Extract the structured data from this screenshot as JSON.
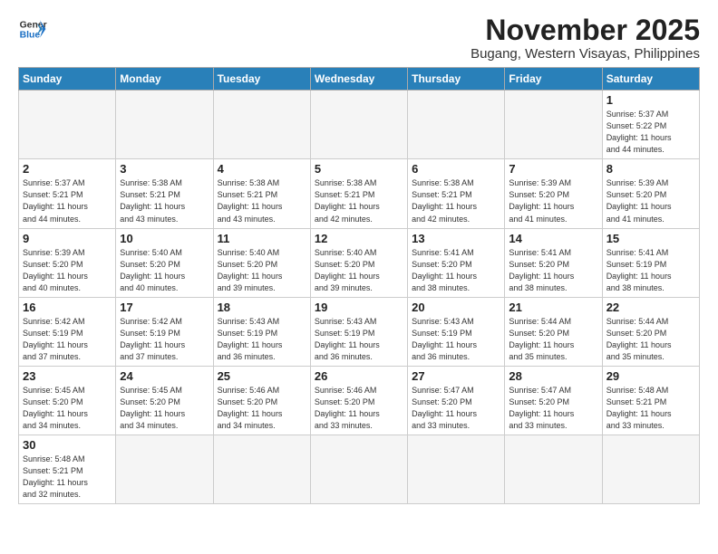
{
  "header": {
    "logo_general": "General",
    "logo_blue": "Blue",
    "title": "November 2025",
    "subtitle": "Bugang, Western Visayas, Philippines"
  },
  "weekdays": [
    "Sunday",
    "Monday",
    "Tuesday",
    "Wednesday",
    "Thursday",
    "Friday",
    "Saturday"
  ],
  "weeks": [
    [
      {
        "day": "",
        "info": ""
      },
      {
        "day": "",
        "info": ""
      },
      {
        "day": "",
        "info": ""
      },
      {
        "day": "",
        "info": ""
      },
      {
        "day": "",
        "info": ""
      },
      {
        "day": "",
        "info": ""
      },
      {
        "day": "1",
        "info": "Sunrise: 5:37 AM\nSunset: 5:22 PM\nDaylight: 11 hours\nand 44 minutes."
      }
    ],
    [
      {
        "day": "2",
        "info": "Sunrise: 5:37 AM\nSunset: 5:21 PM\nDaylight: 11 hours\nand 44 minutes."
      },
      {
        "day": "3",
        "info": "Sunrise: 5:38 AM\nSunset: 5:21 PM\nDaylight: 11 hours\nand 43 minutes."
      },
      {
        "day": "4",
        "info": "Sunrise: 5:38 AM\nSunset: 5:21 PM\nDaylight: 11 hours\nand 43 minutes."
      },
      {
        "day": "5",
        "info": "Sunrise: 5:38 AM\nSunset: 5:21 PM\nDaylight: 11 hours\nand 42 minutes."
      },
      {
        "day": "6",
        "info": "Sunrise: 5:38 AM\nSunset: 5:21 PM\nDaylight: 11 hours\nand 42 minutes."
      },
      {
        "day": "7",
        "info": "Sunrise: 5:39 AM\nSunset: 5:20 PM\nDaylight: 11 hours\nand 41 minutes."
      },
      {
        "day": "8",
        "info": "Sunrise: 5:39 AM\nSunset: 5:20 PM\nDaylight: 11 hours\nand 41 minutes."
      }
    ],
    [
      {
        "day": "9",
        "info": "Sunrise: 5:39 AM\nSunset: 5:20 PM\nDaylight: 11 hours\nand 40 minutes."
      },
      {
        "day": "10",
        "info": "Sunrise: 5:40 AM\nSunset: 5:20 PM\nDaylight: 11 hours\nand 40 minutes."
      },
      {
        "day": "11",
        "info": "Sunrise: 5:40 AM\nSunset: 5:20 PM\nDaylight: 11 hours\nand 39 minutes."
      },
      {
        "day": "12",
        "info": "Sunrise: 5:40 AM\nSunset: 5:20 PM\nDaylight: 11 hours\nand 39 minutes."
      },
      {
        "day": "13",
        "info": "Sunrise: 5:41 AM\nSunset: 5:20 PM\nDaylight: 11 hours\nand 38 minutes."
      },
      {
        "day": "14",
        "info": "Sunrise: 5:41 AM\nSunset: 5:20 PM\nDaylight: 11 hours\nand 38 minutes."
      },
      {
        "day": "15",
        "info": "Sunrise: 5:41 AM\nSunset: 5:19 PM\nDaylight: 11 hours\nand 38 minutes."
      }
    ],
    [
      {
        "day": "16",
        "info": "Sunrise: 5:42 AM\nSunset: 5:19 PM\nDaylight: 11 hours\nand 37 minutes."
      },
      {
        "day": "17",
        "info": "Sunrise: 5:42 AM\nSunset: 5:19 PM\nDaylight: 11 hours\nand 37 minutes."
      },
      {
        "day": "18",
        "info": "Sunrise: 5:43 AM\nSunset: 5:19 PM\nDaylight: 11 hours\nand 36 minutes."
      },
      {
        "day": "19",
        "info": "Sunrise: 5:43 AM\nSunset: 5:19 PM\nDaylight: 11 hours\nand 36 minutes."
      },
      {
        "day": "20",
        "info": "Sunrise: 5:43 AM\nSunset: 5:19 PM\nDaylight: 11 hours\nand 36 minutes."
      },
      {
        "day": "21",
        "info": "Sunrise: 5:44 AM\nSunset: 5:20 PM\nDaylight: 11 hours\nand 35 minutes."
      },
      {
        "day": "22",
        "info": "Sunrise: 5:44 AM\nSunset: 5:20 PM\nDaylight: 11 hours\nand 35 minutes."
      }
    ],
    [
      {
        "day": "23",
        "info": "Sunrise: 5:45 AM\nSunset: 5:20 PM\nDaylight: 11 hours\nand 34 minutes."
      },
      {
        "day": "24",
        "info": "Sunrise: 5:45 AM\nSunset: 5:20 PM\nDaylight: 11 hours\nand 34 minutes."
      },
      {
        "day": "25",
        "info": "Sunrise: 5:46 AM\nSunset: 5:20 PM\nDaylight: 11 hours\nand 34 minutes."
      },
      {
        "day": "26",
        "info": "Sunrise: 5:46 AM\nSunset: 5:20 PM\nDaylight: 11 hours\nand 33 minutes."
      },
      {
        "day": "27",
        "info": "Sunrise: 5:47 AM\nSunset: 5:20 PM\nDaylight: 11 hours\nand 33 minutes."
      },
      {
        "day": "28",
        "info": "Sunrise: 5:47 AM\nSunset: 5:20 PM\nDaylight: 11 hours\nand 33 minutes."
      },
      {
        "day": "29",
        "info": "Sunrise: 5:48 AM\nSunset: 5:21 PM\nDaylight: 11 hours\nand 33 minutes."
      }
    ],
    [
      {
        "day": "30",
        "info": "Sunrise: 5:48 AM\nSunset: 5:21 PM\nDaylight: 11 hours\nand 32 minutes."
      },
      {
        "day": "",
        "info": ""
      },
      {
        "day": "",
        "info": ""
      },
      {
        "day": "",
        "info": ""
      },
      {
        "day": "",
        "info": ""
      },
      {
        "day": "",
        "info": ""
      },
      {
        "day": "",
        "info": ""
      }
    ]
  ]
}
